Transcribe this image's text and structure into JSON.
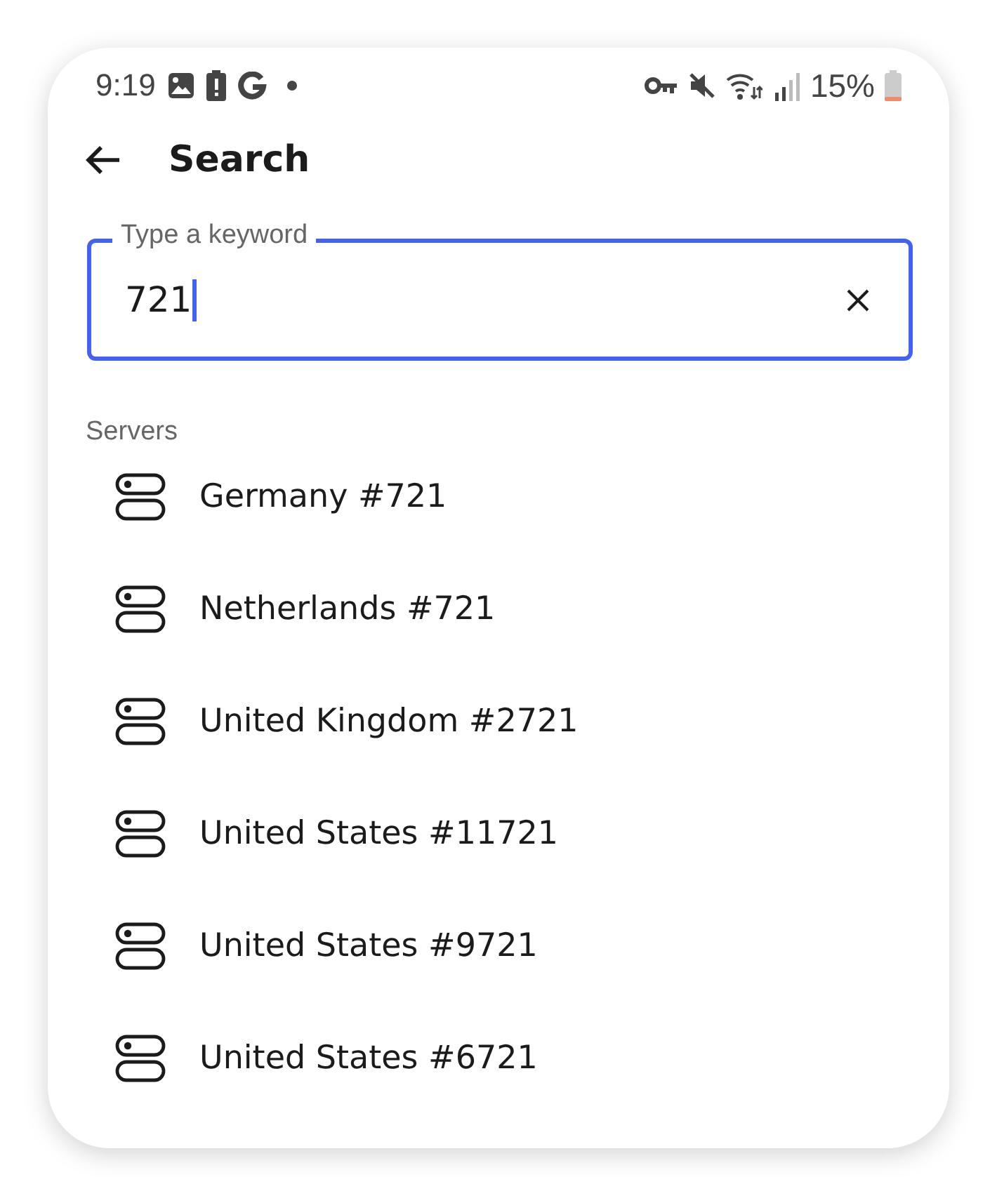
{
  "status_bar": {
    "time": "9:19",
    "battery": "15%"
  },
  "header": {
    "title": "Search"
  },
  "search": {
    "placeholder": "Type a keyword",
    "value": "721",
    "focused": true
  },
  "section": {
    "title": "Servers"
  },
  "servers": [
    {
      "name": "Germany #721"
    },
    {
      "name": "Netherlands #721"
    },
    {
      "name": "United Kingdom #2721"
    },
    {
      "name": "United States #11721"
    },
    {
      "name": "United States #9721"
    },
    {
      "name": "United States #6721"
    }
  ]
}
